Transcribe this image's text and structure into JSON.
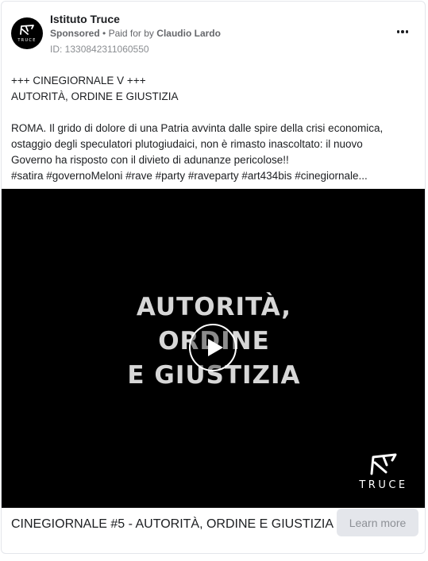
{
  "advertiser": {
    "name": "Istituto Truce",
    "avatar_logo_text": "TRUCE"
  },
  "sponsor": {
    "label": "Sponsored",
    "separator": "•",
    "paid_for_by_label": "Paid for by",
    "payer": "Claudio Lardo"
  },
  "ad_id": "ID: 1330842311060550",
  "more_icon": "more-horizontal-icon",
  "body": {
    "lines": [
      "+++ CINEGIORNALE V +++",
      "AUTORITÀ, ORDINE E GIUSTIZIA",
      "ROMA. Il grido di dolore di una Patria avvinta dalle spire della crisi economica,",
      "ostaggio degli speculatori plutogiudaici, non è rimasto inascoltato: il nuovo",
      "Governo ha risposto con il divieto di adunanze pericolose!!",
      "#satira #governoMeloni #rave #party #raveparty #art434bis #cinegiornale..."
    ]
  },
  "video": {
    "title_lines": [
      "AUTORITÀ,",
      "ORDINE",
      "E GIUSTIZIA"
    ],
    "logo_text": "TRUCE",
    "play_icon": "play-icon"
  },
  "footer": {
    "title": "CINEGIORNALE #5 - AUTORITÀ, ORDINE E GIUSTIZIA",
    "cta_label": "Learn more"
  },
  "colors": {
    "text_primary": "#1c1e21",
    "text_secondary": "#65676b",
    "button_bg": "#e4e6eb",
    "video_bg": "#000000"
  }
}
